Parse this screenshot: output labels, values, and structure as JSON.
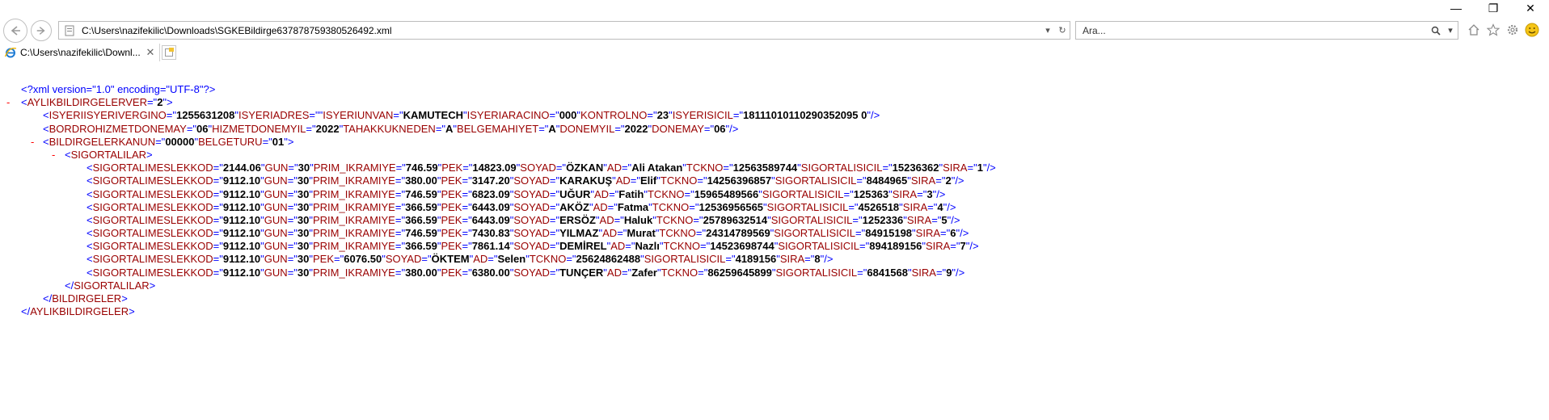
{
  "window": {
    "minimize": "—",
    "restore": "❐",
    "close": "✕"
  },
  "toolbar": {
    "address": "C:\\Users\\nazifekilic\\Downloads\\SGKEBildirge637878759380526492.xml",
    "search_placeholder": "Ara...",
    "icons": [
      "back-icon",
      "forward-icon",
      "home-icon",
      "favorites-star-icon",
      "settings-gear-icon",
      "smiley-feedback-icon"
    ]
  },
  "tabs": [
    {
      "label": "C:\\Users\\nazifekilic\\Downl...",
      "close": "✕"
    }
  ],
  "xml": {
    "collapse_symbol": "-",
    "declaration": "<?xml version=\"1.0\" encoding=\"UTF-8\"?>",
    "root": {
      "tag": "AYLIKBILDIRGELER",
      "attrs": [
        [
          "VER",
          "2"
        ]
      ]
    },
    "isyeri": {
      "tag": "ISYERI",
      "attrs": [
        [
          "ISYERIVERGINO",
          "1255631208"
        ],
        [
          "ISYERIADRES",
          ""
        ],
        [
          "ISYERIUNVAN",
          "KAMUTECH"
        ],
        [
          "ISYERIARACINO",
          "000"
        ],
        [
          "KONTROLNO",
          "23"
        ],
        [
          "ISYERISICIL",
          "18111010110290352095 0"
        ]
      ]
    },
    "bordro": {
      "tag": "BORDRO",
      "attrs": [
        [
          "HIZMETDONEMAY",
          "06"
        ],
        [
          "HIZMETDONEMYIL",
          "2022"
        ],
        [
          "TAHAKKUKNEDEN",
          "A"
        ],
        [
          "BELGEMAHIYET",
          "A"
        ],
        [
          "DONEMYIL",
          "2022"
        ],
        [
          "DONEMAY",
          "06"
        ]
      ]
    },
    "bildirgeler": {
      "tag": "BILDIRGELER",
      "attrs": [
        [
          "KANUN",
          "00000"
        ],
        [
          "BELGETURU",
          "01"
        ]
      ]
    },
    "sigortalilar_tag": "SIGORTALILAR",
    "sigortali_tag": "SIGORTALI",
    "sigortalilar": [
      [
        [
          "MESLEKKOD",
          "2144.06"
        ],
        [
          "GUN",
          "30"
        ],
        [
          "PRIM_IKRAMIYE",
          "746.59"
        ],
        [
          "PEK",
          "14823.09"
        ],
        [
          "SOYAD",
          "ÖZKAN"
        ],
        [
          "AD",
          "Ali Atakan"
        ],
        [
          "TCKNO",
          "12563589744"
        ],
        [
          "SIGORTALISICIL",
          "15236362"
        ],
        [
          "SIRA",
          "1"
        ]
      ],
      [
        [
          "MESLEKKOD",
          "9112.10"
        ],
        [
          "GUN",
          "30"
        ],
        [
          "PRIM_IKRAMIYE",
          "380.00"
        ],
        [
          "PEK",
          "3147.20"
        ],
        [
          "SOYAD",
          "KARAKUŞ"
        ],
        [
          "AD",
          "Elif"
        ],
        [
          "TCKNO",
          "14256396857"
        ],
        [
          "SIGORTALISICIL",
          "8484965"
        ],
        [
          "SIRA",
          "2"
        ]
      ],
      [
        [
          "MESLEKKOD",
          "9112.10"
        ],
        [
          "GUN",
          "30"
        ],
        [
          "PRIM_IKRAMIYE",
          "746.59"
        ],
        [
          "PEK",
          "6823.09"
        ],
        [
          "SOYAD",
          "UĞUR"
        ],
        [
          "AD",
          "Fatih"
        ],
        [
          "TCKNO",
          "15965489566"
        ],
        [
          "SIGORTALISICIL",
          "125363"
        ],
        [
          "SIRA",
          "3"
        ]
      ],
      [
        [
          "MESLEKKOD",
          "9112.10"
        ],
        [
          "GUN",
          "30"
        ],
        [
          "PRIM_IKRAMIYE",
          "366.59"
        ],
        [
          "PEK",
          "6443.09"
        ],
        [
          "SOYAD",
          "AKÖZ"
        ],
        [
          "AD",
          "Fatma"
        ],
        [
          "TCKNO",
          "12536956565"
        ],
        [
          "SIGORTALISICIL",
          "4526518"
        ],
        [
          "SIRA",
          "4"
        ]
      ],
      [
        [
          "MESLEKKOD",
          "9112.10"
        ],
        [
          "GUN",
          "30"
        ],
        [
          "PRIM_IKRAMIYE",
          "366.59"
        ],
        [
          "PEK",
          "6443.09"
        ],
        [
          "SOYAD",
          "ERSÖZ"
        ],
        [
          "AD",
          "Haluk"
        ],
        [
          "TCKNO",
          "25789632514"
        ],
        [
          "SIGORTALISICIL",
          "1252336"
        ],
        [
          "SIRA",
          "5"
        ]
      ],
      [
        [
          "MESLEKKOD",
          "9112.10"
        ],
        [
          "GUN",
          "30"
        ],
        [
          "PRIM_IKRAMIYE",
          "746.59"
        ],
        [
          "PEK",
          "7430.83"
        ],
        [
          "SOYAD",
          "YILMAZ"
        ],
        [
          "AD",
          "Murat"
        ],
        [
          "TCKNO",
          "24314789569"
        ],
        [
          "SIGORTALISICIL",
          "84915198"
        ],
        [
          "SIRA",
          "6"
        ]
      ],
      [
        [
          "MESLEKKOD",
          "9112.10"
        ],
        [
          "GUN",
          "30"
        ],
        [
          "PRIM_IKRAMIYE",
          "366.59"
        ],
        [
          "PEK",
          "7861.14"
        ],
        [
          "SOYAD",
          "DEMİREL"
        ],
        [
          "AD",
          "Nazlı"
        ],
        [
          "TCKNO",
          "14523698744"
        ],
        [
          "SIGORTALISICIL",
          "894189156"
        ],
        [
          "SIRA",
          "7"
        ]
      ],
      [
        [
          "MESLEKKOD",
          "9112.10"
        ],
        [
          "GUN",
          "30"
        ],
        [
          "PEK",
          "6076.50"
        ],
        [
          "SOYAD",
          "ÖKTEM"
        ],
        [
          "AD",
          "Selen"
        ],
        [
          "TCKNO",
          "25624862488"
        ],
        [
          "SIGORTALISICIL",
          "4189156"
        ],
        [
          "SIRA",
          "8"
        ]
      ],
      [
        [
          "MESLEKKOD",
          "9112.10"
        ],
        [
          "GUN",
          "30"
        ],
        [
          "PRIM_IKRAMIYE",
          "380.00"
        ],
        [
          "PEK",
          "6380.00"
        ],
        [
          "SOYAD",
          "TUNÇER"
        ],
        [
          "AD",
          "Zafer"
        ],
        [
          "TCKNO",
          "86259645899"
        ],
        [
          "SIGORTALISICIL",
          "6841568"
        ],
        [
          "SIRA",
          "9"
        ]
      ]
    ]
  }
}
